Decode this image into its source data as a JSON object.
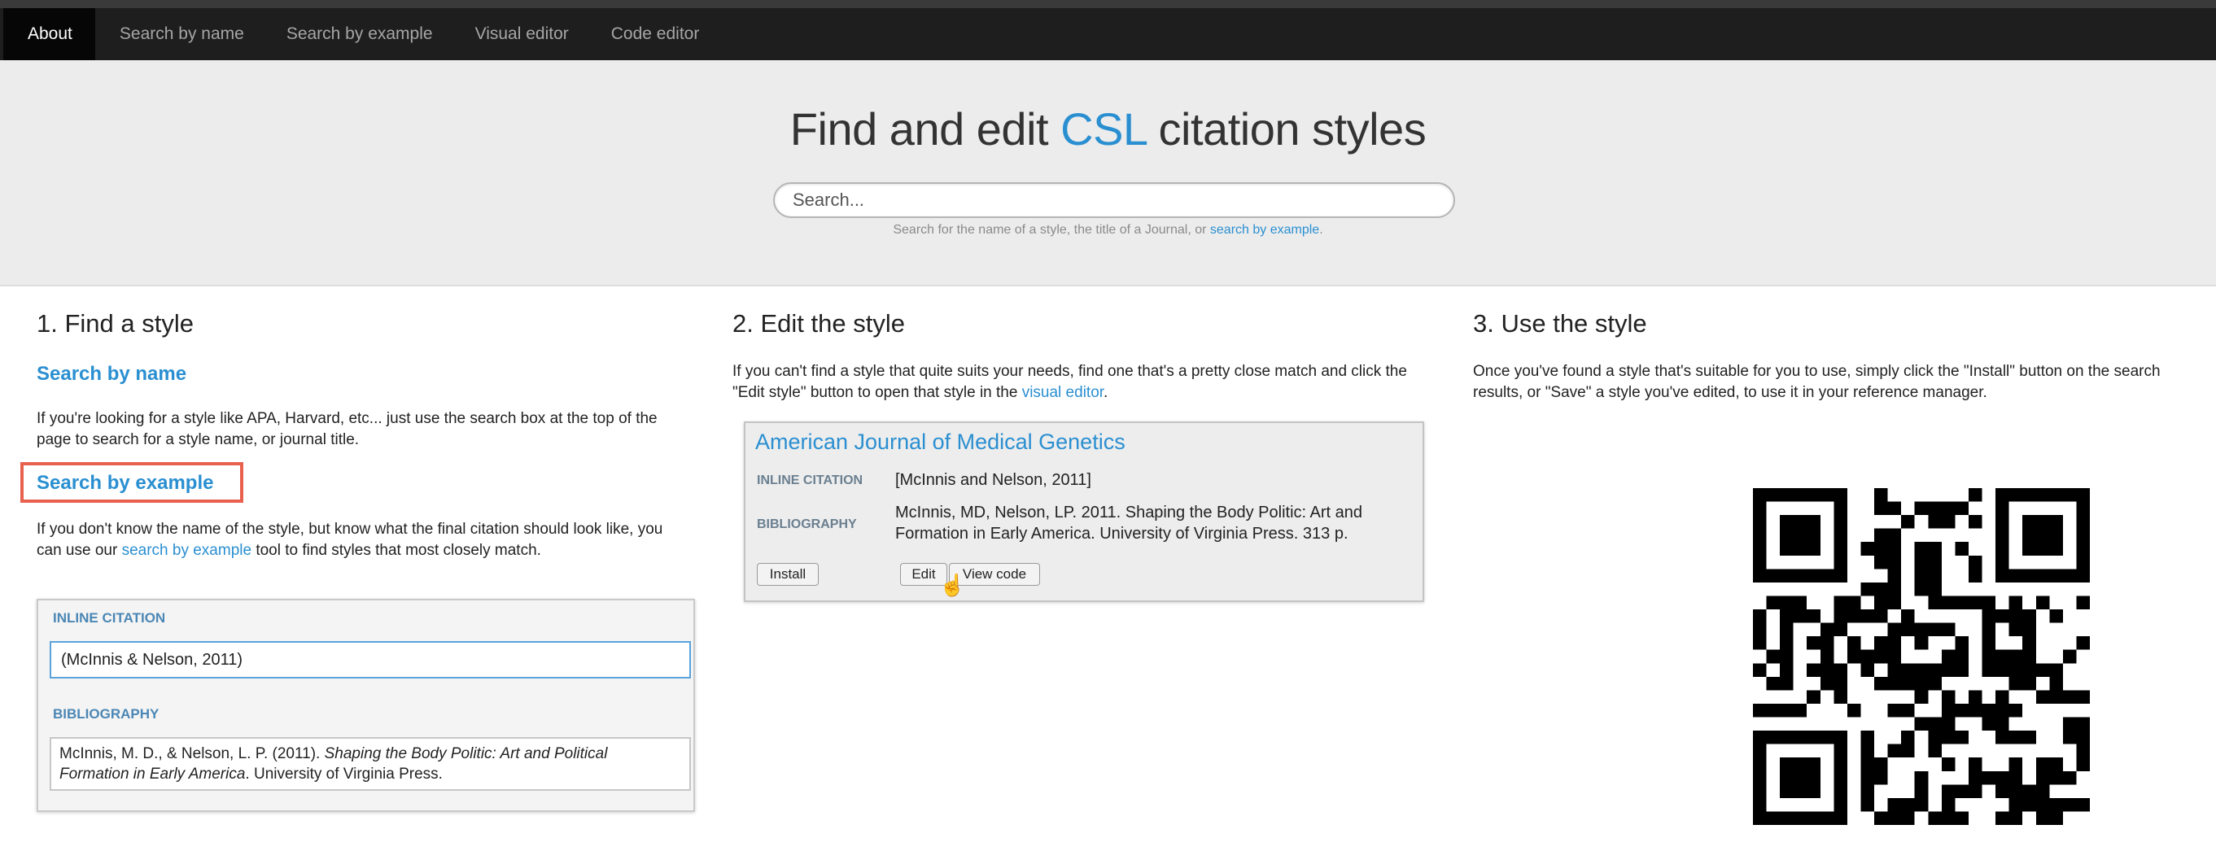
{
  "nav": {
    "items": [
      "About",
      "Search by name",
      "Search by example",
      "Visual editor",
      "Code editor"
    ],
    "active": "About"
  },
  "hero": {
    "title_prefix": "Find and edit ",
    "title_accent": "CSL",
    "title_suffix": " citation styles",
    "search_placeholder": "Search...",
    "hint_text": "Search for the name of a style, the title of a Journal, or ",
    "hint_link": "search by example",
    "hint_end": "."
  },
  "find": {
    "heading": "1. Find a style",
    "by_name_title": "Search by name",
    "by_name_text": "If you're looking for a style like APA, Harvard, etc... just use the search box at the top of the page to search for a style name, or journal title.",
    "by_example_title": "Search by example",
    "by_example_text_1": "If you don't know the name of the style, but know what the final citation should look like, you can use our ",
    "by_example_link": "search by example",
    "by_example_text_2": " tool to find styles that most closely match.",
    "panel": {
      "inline_label": "INLINE CITATION",
      "inline_value": "(McInnis & Nelson, 2011)",
      "bib_label": "BIBLIOGRAPHY",
      "bib_plain": "McInnis, M. D., & Nelson, L. P. (2011). ",
      "bib_italic": "Shaping the Body Politic: Art and Political Formation in Early America",
      "bib_end": ". University of Virginia Press."
    }
  },
  "edit": {
    "heading": "2. Edit the style",
    "text_1": "If you can't find a style that quite suits your needs, find one that's a pretty close match and click the \"Edit style\" button to open that style in the ",
    "link": "visual editor",
    "text_2": ".",
    "card": {
      "title": "American Journal of Medical Genetics",
      "inline_label": "INLINE CITATION",
      "inline_value": "[McInnis and Nelson, 2011]",
      "bib_label": "BIBLIOGRAPHY",
      "bib_value_1": "McInnis, MD, Nelson, LP. 2011. Shaping the Body Politic: Art and",
      "bib_value_2": "Formation in Early America. University of Virginia Press. 313 p.",
      "install_label": "Install",
      "edit_label": "Edit",
      "view_code_label": "View code"
    }
  },
  "use": {
    "heading": "3. Use the style",
    "text": "Once you've found a style that's suitable for you to use, simply click the \"Install\" button on the search results, or \"Save\" a style you've edited, to use it in your reference manager.",
    "qr_icon": "qr-code-icon"
  },
  "colors": {
    "accent": "#2a8fd1",
    "highlight": "#e8614f",
    "navbar": "#1e1e1e"
  }
}
